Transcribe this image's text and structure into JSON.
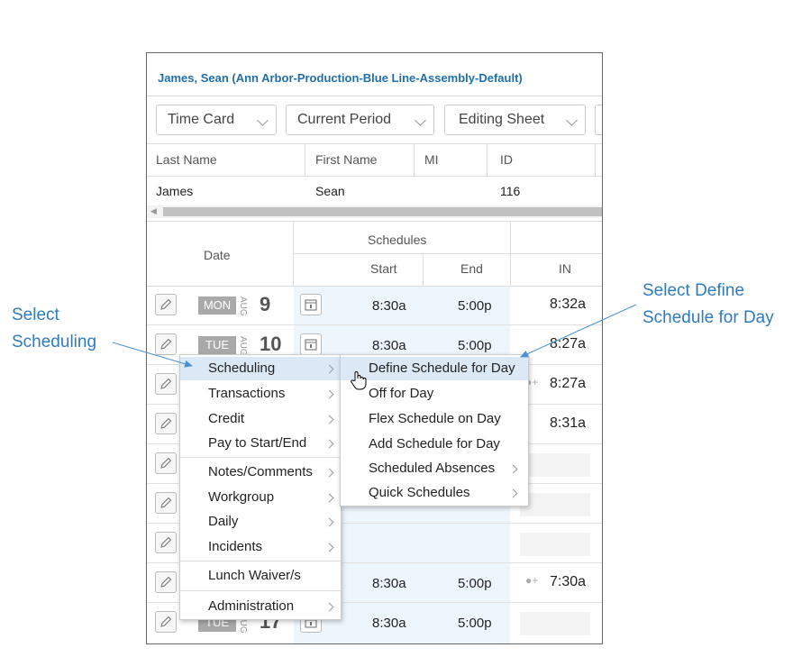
{
  "header": {
    "title": "James, Sean (Ann Arbor-Production-Blue Line-Assembly-Default)"
  },
  "toolbar": {
    "time_card": "Time Card",
    "period": "Current Period",
    "sheet": "Editing Sheet"
  },
  "employee_table": {
    "columns": [
      "Last Name",
      "First Name",
      "MI",
      "ID"
    ],
    "row": {
      "last": "James",
      "first": "Sean",
      "mi": "",
      "id": "116"
    }
  },
  "grid": {
    "date_header": "Date",
    "schedules_header": "Schedules",
    "start_header": "Start",
    "end_header": "End",
    "in_header": "IN",
    "month": "AUG",
    "rows": [
      {
        "dow": "MON",
        "day": "9",
        "start": "8:30a",
        "end": "5:00p",
        "in": "8:32a"
      },
      {
        "dow": "TUE",
        "day": "10",
        "start": "8:30a",
        "end": "5:00p",
        "in": "8:27a"
      },
      {
        "in": "8:27a"
      },
      {
        "in": "8:31a"
      },
      {},
      {},
      {},
      {
        "start": "8:30a",
        "end": "5:00p",
        "in": "7:30a"
      },
      {
        "dow": "TUE",
        "day": "17",
        "start": "8:30a",
        "end": "5:00p"
      }
    ]
  },
  "context_menu": {
    "items": [
      "Scheduling",
      "Transactions",
      "Credit",
      "Pay to Start/End",
      "Notes/Comments",
      "Workgroup",
      "Daily",
      "Incidents",
      "Lunch Waiver/s",
      "Administration"
    ]
  },
  "submenu": {
    "items": [
      "Define Schedule for Day",
      "Off for Day",
      "Flex Schedule on Day",
      "Add Schedule for Day",
      "Scheduled Absences",
      "Quick Schedules"
    ]
  },
  "annotations": {
    "left_line1": "Select",
    "left_line2": "Scheduling",
    "right_line1": "Select Define",
    "right_line2": "Schedule for Day"
  },
  "colors": {
    "accent": "#2e7bc0",
    "link": "#1f6fae",
    "highlight": "#dbe9f7",
    "schedule_column": "#eef6fd"
  }
}
